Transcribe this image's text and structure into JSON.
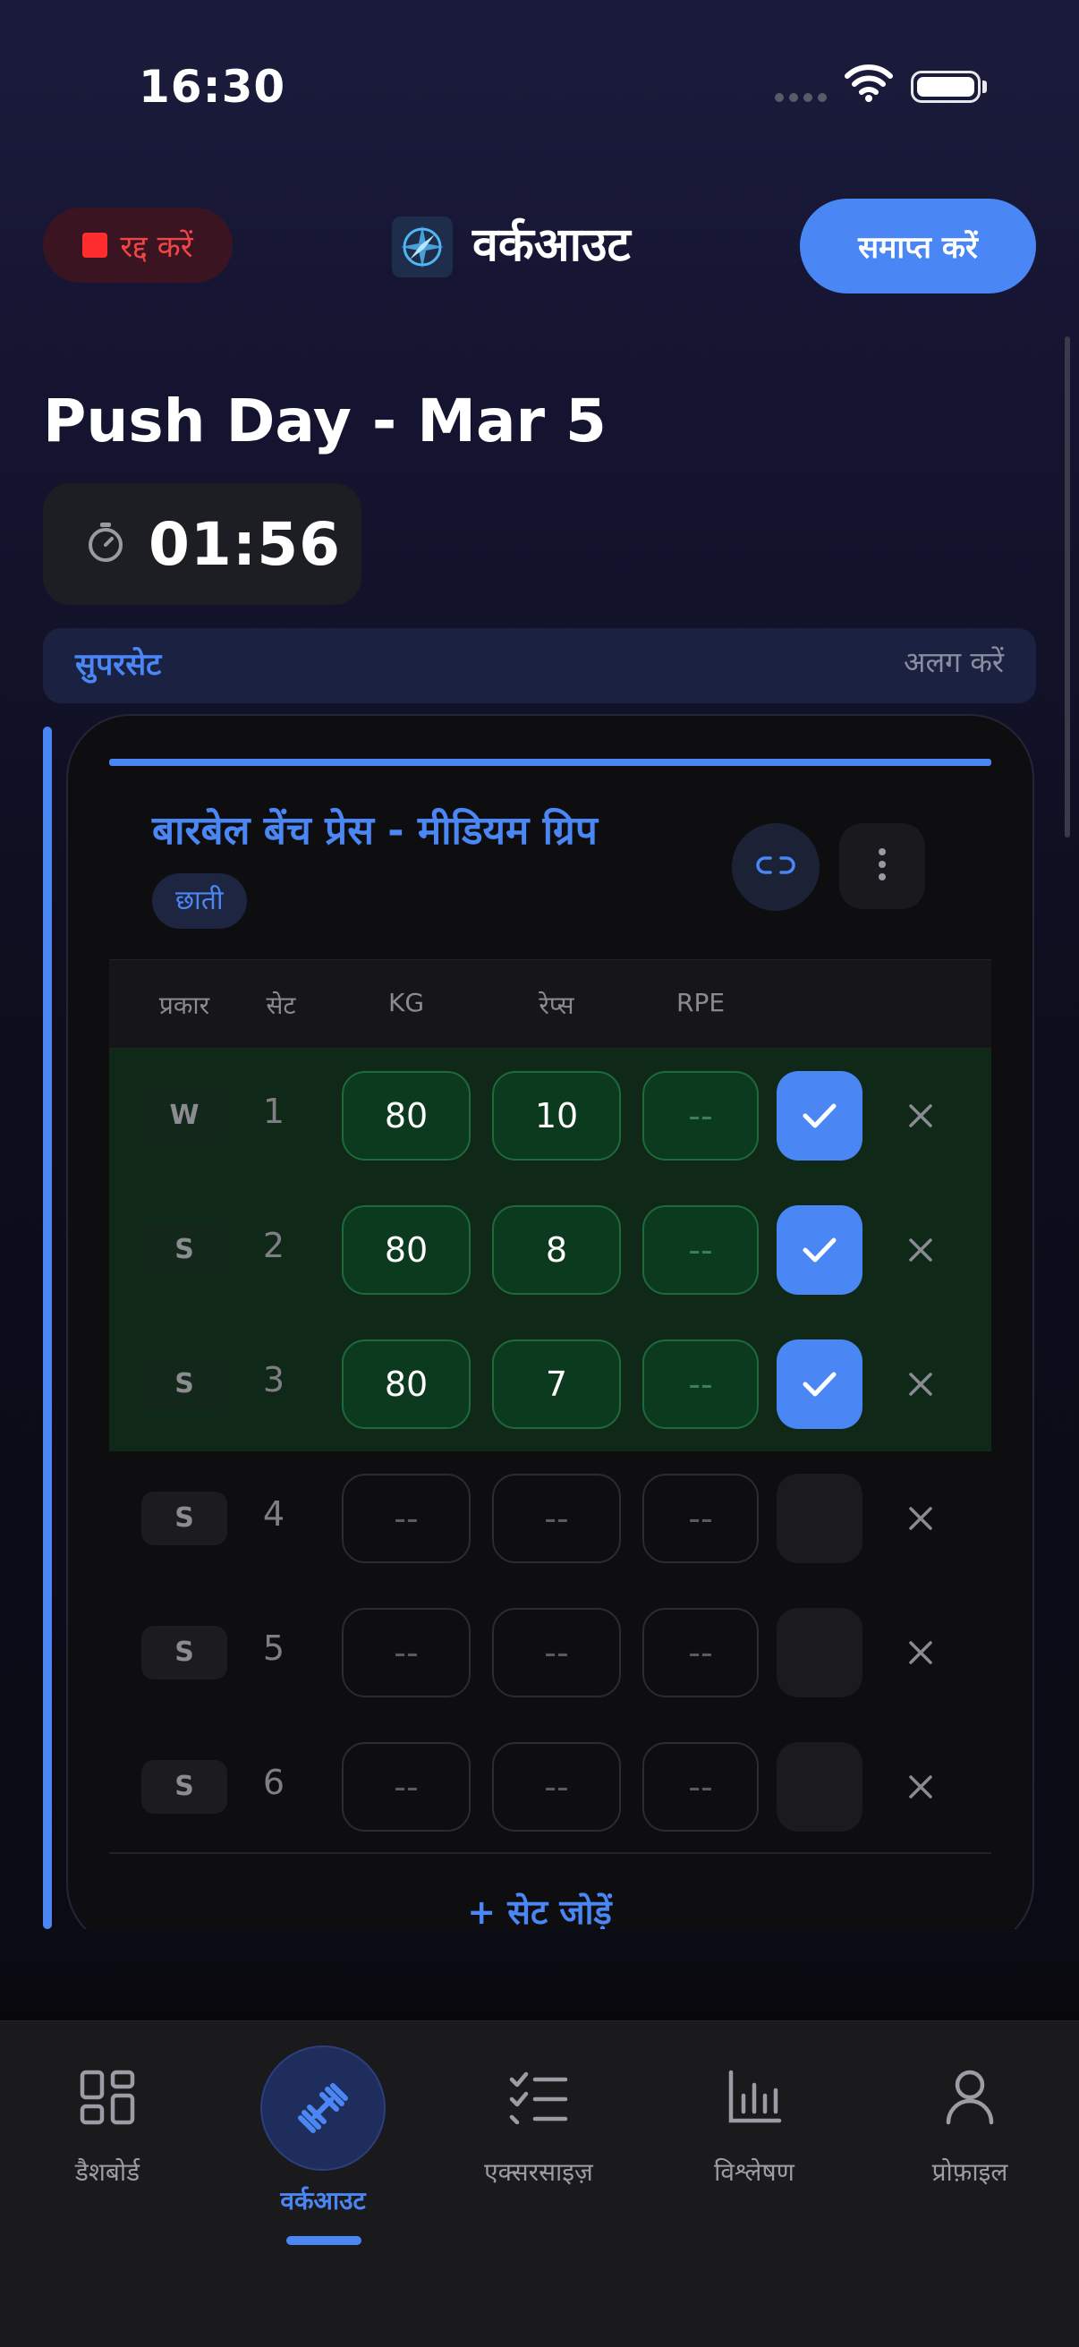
{
  "status_bar": {
    "time": "16:30"
  },
  "header": {
    "cancel_label": "रद्द करें",
    "title": "वर्कआउट",
    "finish_label": "समाप्त करें"
  },
  "workout": {
    "title": "Push Day - Mar 5",
    "timer": "01:56"
  },
  "superset": {
    "label": "सुपरसेट",
    "separate_label": "अलग करें"
  },
  "exercise": {
    "name": "बारबेल बेंच प्रेस - मीडियम ग्रिप",
    "muscle": "छाती",
    "columns": {
      "type": "प्रकार",
      "set": "सेट",
      "kg": "KG",
      "reps": "रेप्स",
      "rpe": "RPE"
    },
    "sets": [
      {
        "type": "W",
        "num": "1",
        "kg": "80",
        "reps": "10",
        "rpe": "--",
        "done": true
      },
      {
        "type": "S",
        "num": "2",
        "kg": "80",
        "reps": "8",
        "rpe": "--",
        "done": true
      },
      {
        "type": "S",
        "num": "3",
        "kg": "80",
        "reps": "7",
        "rpe": "--",
        "done": true
      },
      {
        "type": "S",
        "num": "4",
        "kg": "--",
        "reps": "--",
        "rpe": "--",
        "done": false
      },
      {
        "type": "S",
        "num": "5",
        "kg": "--",
        "reps": "--",
        "rpe": "--",
        "done": false
      },
      {
        "type": "S",
        "num": "6",
        "kg": "--",
        "reps": "--",
        "rpe": "--",
        "done": false
      }
    ],
    "add_set_label": "+  सेट जोड़ें"
  },
  "nav": [
    {
      "label": "डैशबोर्ड",
      "icon": "dashboard-icon",
      "active": false
    },
    {
      "label": "वर्कआउट",
      "icon": "dumbbell-icon",
      "active": true
    },
    {
      "label": "एक्सरसाइज़",
      "icon": "checklist-icon",
      "active": false
    },
    {
      "label": "विश्लेषण",
      "icon": "bar-chart-icon",
      "active": false
    },
    {
      "label": "प्रोफ़ाइल",
      "icon": "person-icon",
      "active": false
    }
  ],
  "colors": {
    "accent": "#4a86f4",
    "danger": "#ff2d2d",
    "success_bg": "#0f2817"
  }
}
